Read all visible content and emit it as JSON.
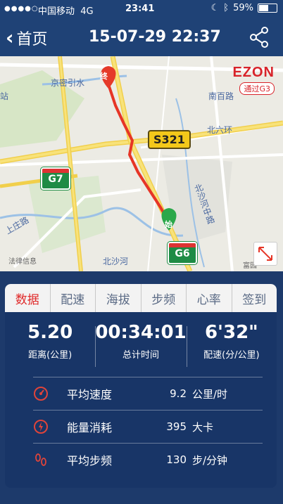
{
  "status_bar": {
    "signal": "●●●●○",
    "carrier": "中国移动",
    "network": "4G",
    "time": "23:41",
    "battery": "59%",
    "battery_level": 0.59
  },
  "header": {
    "back_label": "首页",
    "title": "15-07-29 22:37"
  },
  "map": {
    "brand": "EZON",
    "brand_sub": "通过G3",
    "labels": {
      "jingmi": "京密引水",
      "nanbaixin": "南百路",
      "beiliuhuan": "北六环",
      "beisha": "北沙河中路",
      "shangzhuang": "上庄路",
      "beishahe": "北沙河",
      "zhan": "站",
      "yuan": "富园",
      "copyright": "法律信息"
    },
    "road_s321": "S321",
    "road_g7": "G7",
    "road_g6": "G6",
    "start_marker": "始",
    "end_marker": "终",
    "colors": {
      "route": "#e63526",
      "start": "#2aa84a",
      "end": "#e53a2a"
    }
  },
  "tabs": [
    "数据",
    "配速",
    "海拔",
    "步频",
    "心率",
    "签到"
  ],
  "summary": [
    {
      "value": "5.20",
      "label": "距离(公里)"
    },
    {
      "value": "00:34:01",
      "label": "总计时间"
    },
    {
      "value": "6'32\"",
      "label": "配速(分/公里)"
    }
  ],
  "details": [
    {
      "icon": "speed-icon",
      "name": "平均速度",
      "value": "9.2",
      "unit": "公里/时"
    },
    {
      "icon": "energy-icon",
      "name": "能量消耗",
      "value": "395",
      "unit": "大卡"
    },
    {
      "icon": "footsteps-icon",
      "name": "平均步频",
      "value": "130",
      "unit": "步/分钟"
    }
  ]
}
